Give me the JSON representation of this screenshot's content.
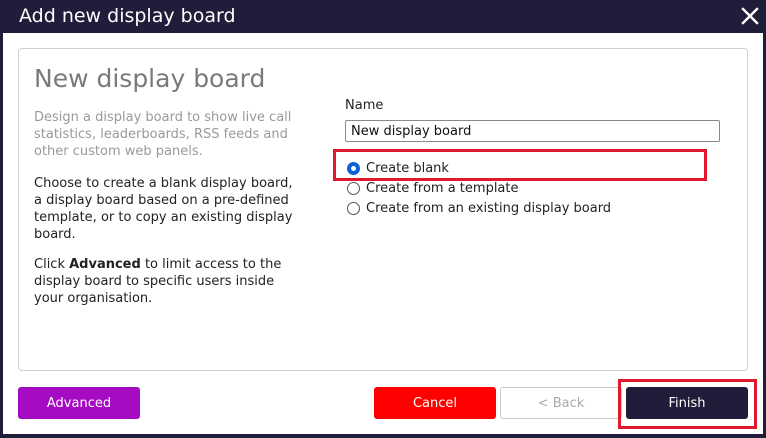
{
  "window": {
    "title": "Add new display board",
    "close_icon": "close-icon"
  },
  "panel": {
    "heading": "New display board",
    "intro": "Design a display board to show live call statistics, leaderboards, RSS feeds and other custom web panels.",
    "paragraph1": "Choose to create a blank display board, a display board based on a pre-defined template, or to copy an existing display board.",
    "paragraph2_prefix": "Click ",
    "paragraph2_bold": "Advanced",
    "paragraph2_suffix": " to limit access to the display board to specific users inside your organisation."
  },
  "form": {
    "name_label": "Name",
    "name_value": "New display board",
    "options": [
      {
        "label": "Create blank",
        "selected": true
      },
      {
        "label": "Create from a template",
        "selected": false
      },
      {
        "label": "Create from an existing display board",
        "selected": false
      }
    ]
  },
  "buttons": {
    "advanced": "Advanced",
    "cancel": "Cancel",
    "back": "< Back",
    "finish": "Finish"
  },
  "colors": {
    "title_bar": "#1f1d3a",
    "advanced": "#a50bc3",
    "cancel": "#ff0000",
    "finish": "#1f1d3a",
    "highlight": "#e0192c"
  }
}
